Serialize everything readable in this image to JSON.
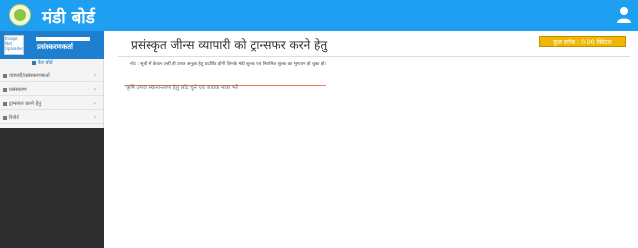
{
  "header": {
    "app_title": "मंडी बोर्ड",
    "logo_icon": "mandi-board-logo",
    "user_icon": "user-icon",
    "color": "#1e9ff2"
  },
  "sidebar": {
    "avatar_alt": "Image Not Uploaded",
    "role": "प्रसंस्करणकर्ता",
    "home_label": "डैश बोर्ड",
    "items": [
      {
        "label": "व्यापारी/प्रसंस्करणकर्ता",
        "icon": "user-icon"
      },
      {
        "label": "प्रसंस्करण",
        "icon": "cart-icon"
      },
      {
        "label": "ट्रान्सफर करने हेतु",
        "icon": "truck-icon"
      },
      {
        "label": "रिपोर्ट",
        "icon": "report-icon"
      }
    ]
  },
  "main": {
    "title": "प्रसंस्कृत जीन्स व्यापारी को ट्रान्सफर करने हेतु",
    "stock_badge": "कुल स्टॉक : 0.00 क्विंटल",
    "note": "नोट : सूची में केवल उन्हीं ही उपज अनुज्ञा हेतु प्रदर्शित होंगी जिनके मंडी शुल्क एवं निराश्रित शुल्क का भुगतान हो चुका हो।",
    "select_placeholder": "कृषि उपज स्थानान्तरण हेतु लॉट चुने एवं जावक मात्रा भरें"
  }
}
